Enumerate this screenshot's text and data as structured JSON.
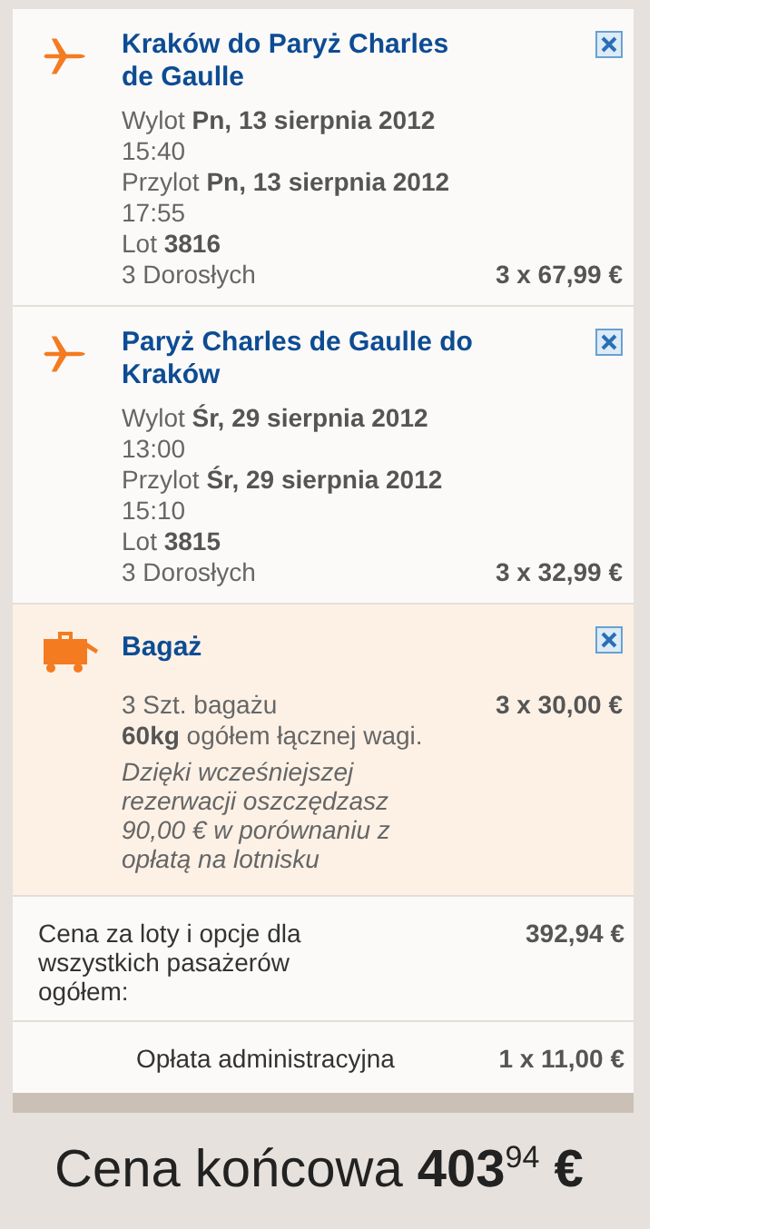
{
  "items": [
    {
      "kind": "flight",
      "title": "Kraków do Paryż Charles de Gaulle",
      "lines": [
        "Wylot **Pn, 13 sierpnia 2012**",
        "15:40",
        "Przylot **Pn, 13 sierpnia 2012**",
        "17:55",
        "Lot **3816**"
      ],
      "passengers": "3 Dorosłych",
      "price": "3 x 67,99 €"
    },
    {
      "kind": "flight",
      "title": "Paryż Charles de Gaulle do Kraków",
      "lines": [
        "Wylot **Śr, 29 sierpnia 2012**",
        "13:00",
        "Przylot **Śr, 29 sierpnia 2012**",
        "15:10",
        "Lot **3815**"
      ],
      "passengers": "3 Dorosłych",
      "price": "3 x 32,99 €"
    },
    {
      "kind": "baggage",
      "title": "Bagaż",
      "lines": [
        "3 Szt. bagażu",
        "**60kg** ogółem łącznej wagi."
      ],
      "note": "Dzięki wcześniejszej rezerwacji oszczędzasz 90,00 € w porównaniu z opłatą na lotnisku",
      "price": "3 x 30,00 €"
    }
  ],
  "subtotal": {
    "label": "Cena za loty i opcje dla wszystkich pasażerów ogółem:",
    "amount": "392,94 €"
  },
  "fee": {
    "label": "Opłata administracyjna",
    "amount": "1 x 11,00 €"
  },
  "total": "Cena końcowa **403**$^{94}$ **€**"
}
